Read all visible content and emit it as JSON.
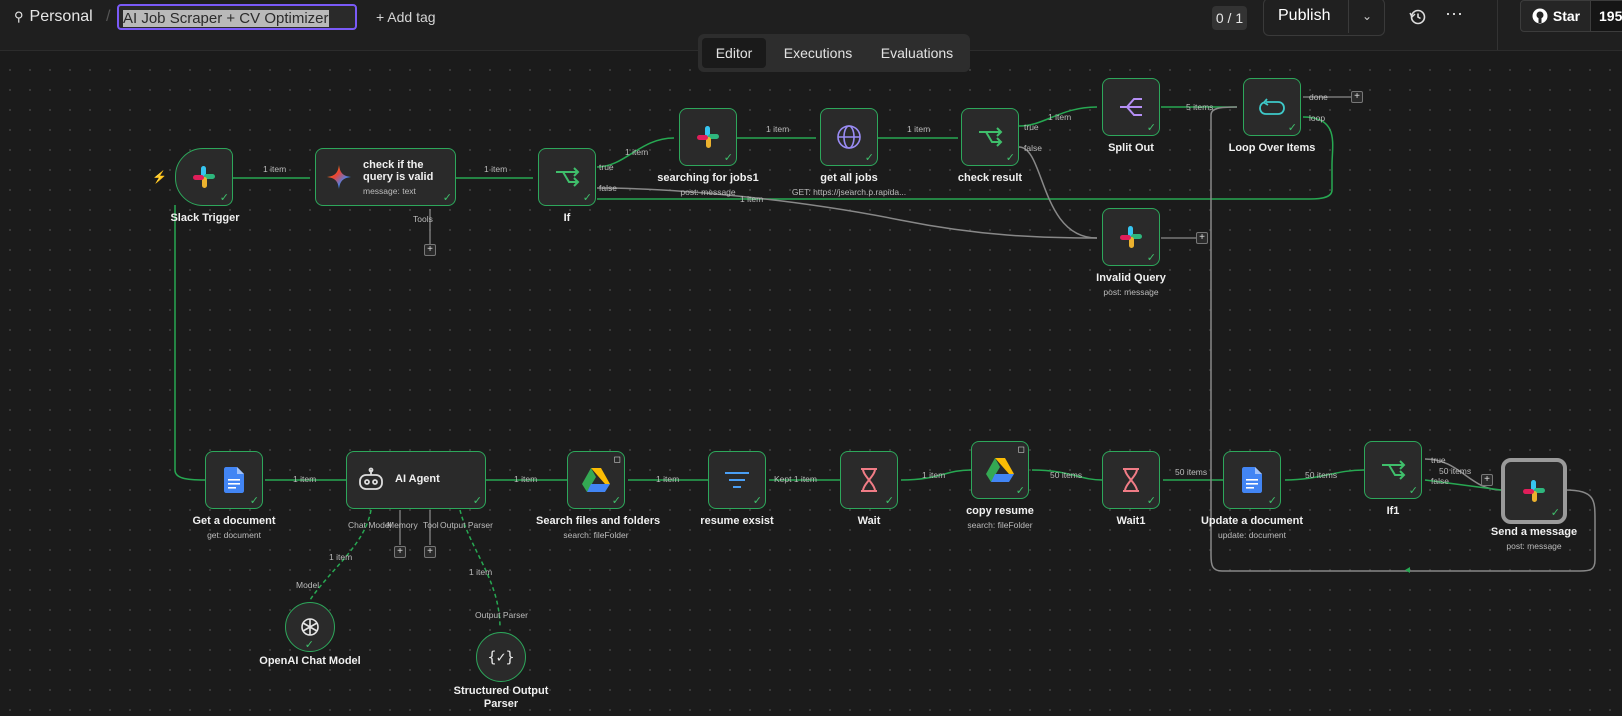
{
  "header": {
    "project": "Personal",
    "separator": "/",
    "workflow_name": "AI Job Scraper + CV Optimizer",
    "add_tag": "Add tag",
    "counter": "0 / 1",
    "publish": "Publish",
    "star": "Star",
    "star_count": "195,"
  },
  "tabs": [
    "Editor",
    "Executions",
    "Evaluations"
  ],
  "nodes": {
    "slack_trigger": {
      "label": "Slack Trigger"
    },
    "check_query": {
      "label": "check if the query is valid",
      "sub": "message: text",
      "port": "Tools"
    },
    "if": {
      "label": "If"
    },
    "searching_jobs": {
      "label": "searching for jobs1",
      "sub": "post: message"
    },
    "get_all_jobs": {
      "label": "get all jobs",
      "sub": "GET: https://jsearch.p.rapida..."
    },
    "check_result": {
      "label": "check result"
    },
    "split_out": {
      "label": "Split Out"
    },
    "loop": {
      "label": "Loop Over Items"
    },
    "invalid_query": {
      "label": "Invalid Query",
      "sub": "post: message"
    },
    "get_document": {
      "label": "Get a document",
      "sub": "get: document"
    },
    "ai_agent": {
      "label": "AI Agent",
      "ports": [
        "Chat Model",
        "Memory",
        "Tool",
        "Output Parser"
      ]
    },
    "search_files": {
      "label": "Search files and folders",
      "sub": "search: fileFolder"
    },
    "resume_exsist": {
      "label": "resume exsist"
    },
    "wait": {
      "label": "Wait"
    },
    "copy_resume": {
      "label": "copy resume",
      "sub": "search: fileFolder"
    },
    "wait1": {
      "label": "Wait1"
    },
    "update_document": {
      "label": "Update a document",
      "sub": "update: document"
    },
    "if1": {
      "label": "If1"
    },
    "send_message": {
      "label": "Send a message",
      "sub": "post: message"
    },
    "openai": {
      "label": "OpenAI Chat Model",
      "port": "Model"
    },
    "parser": {
      "label": "Structured Output Parser",
      "port": "Output Parser"
    }
  },
  "edges": [
    "1 item",
    "1 item",
    "true",
    "false",
    "1 item",
    "1 item",
    "1 item",
    "true",
    "false",
    "1 item",
    "5 items",
    "done",
    "loop",
    "1 item",
    "1 item",
    "1 item",
    "1 item",
    "Kept 1 item",
    "1 item",
    "50 items",
    "50 items",
    "50 items",
    "true",
    "false",
    "50 items",
    "1 item",
    "1 item"
  ],
  "colors": {
    "success": "#2da75b",
    "accent": "#7a5af8",
    "background": "#1b1b1b"
  }
}
